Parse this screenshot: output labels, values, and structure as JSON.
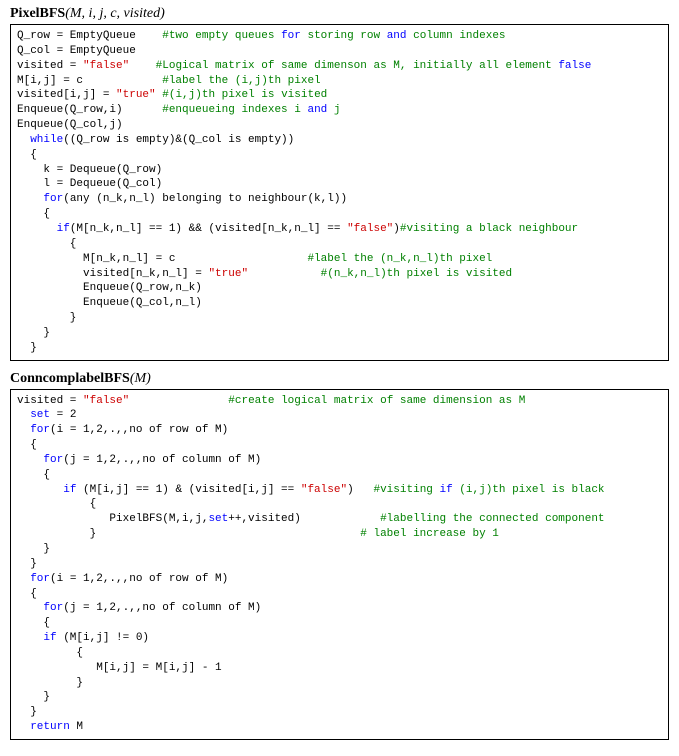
{
  "algo1": {
    "title_name": "PixelBFS",
    "title_args": "(M, i, j, c, visited)",
    "lines": [
      [
        [
          "",
          "Q_row = EmptyQueue    "
        ],
        [
          "cm",
          "#two empty queues "
        ],
        [
          "kw",
          "for"
        ],
        [
          "cm",
          " storing row "
        ],
        [
          "kw",
          "and"
        ],
        [
          "cm",
          " column indexes"
        ]
      ],
      [
        [
          "",
          "Q_col = EmptyQueue"
        ]
      ],
      [
        [
          "",
          "visited = "
        ],
        [
          "str",
          "\"false\""
        ],
        [
          "",
          "    "
        ],
        [
          "cm",
          "#Logical matrix of same dimenson as M, initially all element "
        ],
        [
          "kw",
          "false"
        ]
      ],
      [
        [
          "",
          "M[i,j] = c            "
        ],
        [
          "cm",
          "#label the (i,j)th pixel"
        ]
      ],
      [
        [
          "",
          "visited[i,j] = "
        ],
        [
          "str",
          "\"true\""
        ],
        [
          "",
          " "
        ],
        [
          "cm",
          "#(i,j)th pixel is visited"
        ]
      ],
      [
        [
          "",
          "Enqueue(Q_row,i)      "
        ],
        [
          "cm",
          "#enqueueing indexes i "
        ],
        [
          "kw",
          "and"
        ],
        [
          "cm",
          " j"
        ]
      ],
      [
        [
          "",
          "Enqueue(Q_col,j)"
        ]
      ],
      [
        [
          "",
          "  "
        ],
        [
          "kw",
          "while"
        ],
        [
          "",
          "((Q_row is empty)&(Q_col is empty))"
        ]
      ],
      [
        [
          "",
          "  {"
        ]
      ],
      [
        [
          "",
          "    k = Dequeue(Q_row)"
        ]
      ],
      [
        [
          "",
          "    l = Dequeue(Q_col)"
        ]
      ],
      [
        [
          "",
          "    "
        ],
        [
          "kw",
          "for"
        ],
        [
          "",
          "(any (n_k,n_l) belonging to neighbour(k,l))"
        ]
      ],
      [
        [
          "",
          "    {"
        ]
      ],
      [
        [
          "",
          "      "
        ],
        [
          "kw",
          "if"
        ],
        [
          "",
          "(M[n_k,n_l] == 1) && (visited[n_k,n_l] == "
        ],
        [
          "str",
          "\"false\""
        ],
        [
          "",
          ")"
        ],
        [
          "cm",
          "#visiting a black neighbour"
        ]
      ],
      [
        [
          "",
          "        {"
        ]
      ],
      [
        [
          "",
          "          M[n_k,n_l] = c                    "
        ],
        [
          "cm",
          "#label the (n_k,n_l)th pixel"
        ]
      ],
      [
        [
          "",
          "          visited[n_k,n_l] = "
        ],
        [
          "str",
          "\"true\""
        ],
        [
          "",
          "           "
        ],
        [
          "cm",
          "#(n_k,n_l)th pixel is visited"
        ]
      ],
      [
        [
          "",
          "          Enqueue(Q_row,n_k)"
        ]
      ],
      [
        [
          "",
          "          Enqueue(Q_col,n_l)"
        ]
      ],
      [
        [
          "",
          "        }"
        ]
      ],
      [
        [
          "",
          "    }"
        ]
      ],
      [
        [
          "",
          "  }"
        ]
      ]
    ]
  },
  "algo2": {
    "title_name": "ConncomplabelBFS",
    "title_args": "(M)",
    "lines": [
      [
        [
          "",
          "visited = "
        ],
        [
          "str",
          "\"false\""
        ],
        [
          "",
          "               "
        ],
        [
          "cm",
          "#create logical matrix of same dimension as M"
        ]
      ],
      [
        [
          "",
          "  "
        ],
        [
          "kw",
          "set"
        ],
        [
          "",
          " = 2"
        ]
      ],
      [
        [
          "",
          "  "
        ],
        [
          "kw",
          "for"
        ],
        [
          "",
          "(i = 1,2,.,,no of row of M)"
        ]
      ],
      [
        [
          "",
          "  {"
        ]
      ],
      [
        [
          "",
          "    "
        ],
        [
          "kw",
          "for"
        ],
        [
          "",
          "(j = 1,2,.,,no of column of M)"
        ]
      ],
      [
        [
          "",
          "    {"
        ]
      ],
      [
        [
          "",
          "       "
        ],
        [
          "kw",
          "if"
        ],
        [
          "",
          " (M[i,j] == 1) & (visited[i,j] == "
        ],
        [
          "str",
          "\"false\""
        ],
        [
          "",
          ")   "
        ],
        [
          "cm",
          "#visiting "
        ],
        [
          "kw",
          "if"
        ],
        [
          "cm",
          " (i,j)th pixel is black"
        ]
      ],
      [
        [
          "",
          "           {"
        ]
      ],
      [
        [
          "",
          "              PixelBFS(M,i,j,"
        ],
        [
          "kw",
          "set"
        ],
        [
          "",
          "++,visited)            "
        ],
        [
          "cm",
          "#labelling the connected component"
        ]
      ],
      [
        [
          "",
          "           }                                        "
        ],
        [
          "cm",
          "# label increase by 1"
        ]
      ],
      [
        [
          "",
          "    }"
        ]
      ],
      [
        [
          "",
          "  }"
        ]
      ],
      [
        [
          "",
          "  "
        ],
        [
          "kw",
          "for"
        ],
        [
          "",
          "(i = 1,2,.,,no of row of M)"
        ]
      ],
      [
        [
          "",
          "  {"
        ]
      ],
      [
        [
          "",
          "    "
        ],
        [
          "kw",
          "for"
        ],
        [
          "",
          "(j = 1,2,.,,no of column of M)"
        ]
      ],
      [
        [
          "",
          "    {"
        ]
      ],
      [
        [
          "",
          "    "
        ],
        [
          "kw",
          "if"
        ],
        [
          "",
          " (M[i,j] != 0)"
        ]
      ],
      [
        [
          "",
          "         {"
        ]
      ],
      [
        [
          "",
          "            M[i,j] = M[i,j] - 1"
        ]
      ],
      [
        [
          "",
          "         }"
        ]
      ],
      [
        [
          "",
          "    }"
        ]
      ],
      [
        [
          "",
          "  }"
        ]
      ],
      [
        [
          "",
          "  "
        ],
        [
          "kw",
          "return"
        ],
        [
          "",
          " M"
        ]
      ]
    ]
  }
}
